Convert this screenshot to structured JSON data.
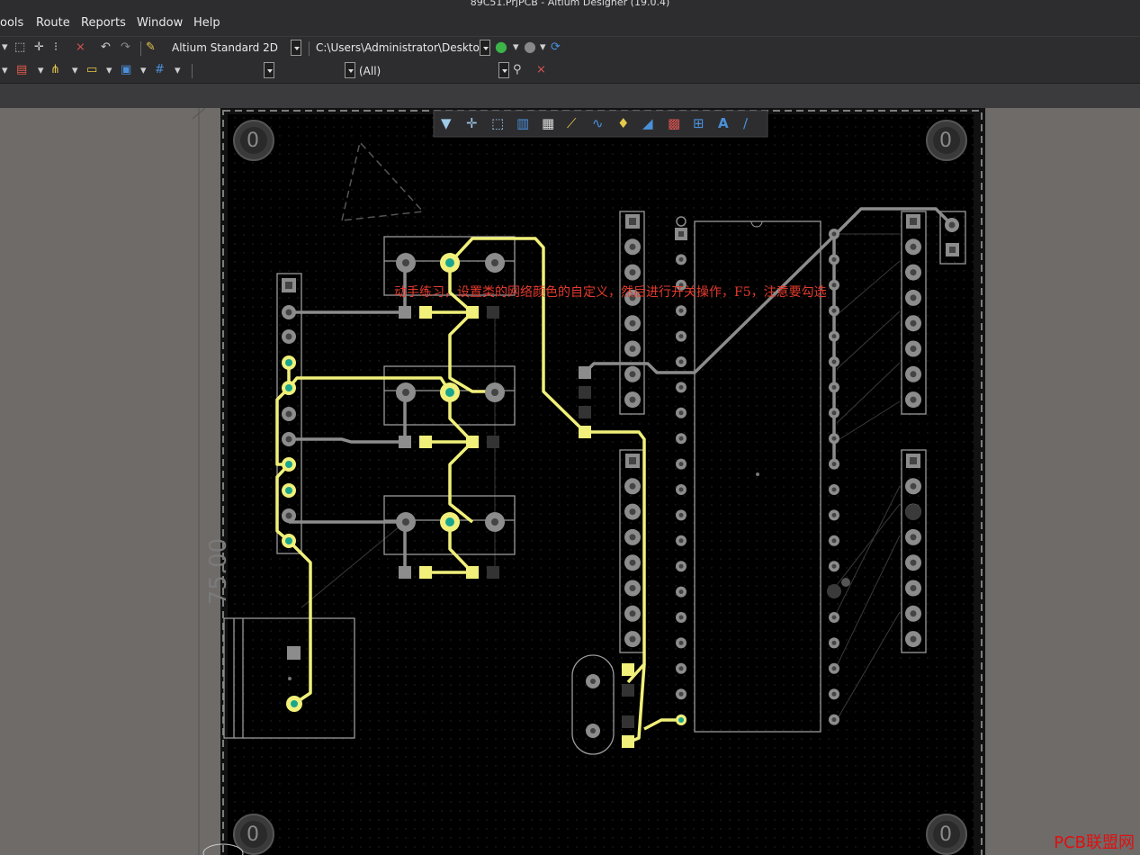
{
  "window": {
    "title": "89C51.PrjPCB - Altium Designer (19.0.4)"
  },
  "menu": [
    {
      "label": "ools",
      "hot": ""
    },
    {
      "label": "Route",
      "hot": "u"
    },
    {
      "label": "Reports",
      "hot": "R"
    },
    {
      "label": "Window",
      "hot": "W"
    },
    {
      "label": "Help",
      "hot": "H"
    }
  ],
  "toolbar": {
    "view_mode": "Altium Standard 2D",
    "path": "C:\\Users\\Administrator\\Deskto",
    "filter_all": "(All)"
  },
  "canvas": {
    "hint_text": "动手练习，设置类的网络颜色的自定义，然后进行开关操作，F5，注意要勾选",
    "dimension_label": "75.00",
    "hole_label": "0",
    "board_color": "#000000",
    "track_color": "#f0f07a",
    "net_color_gray": "#8c8c8c",
    "pad_highlight": "#1aa58e"
  },
  "watermark": "PCB联盟网"
}
